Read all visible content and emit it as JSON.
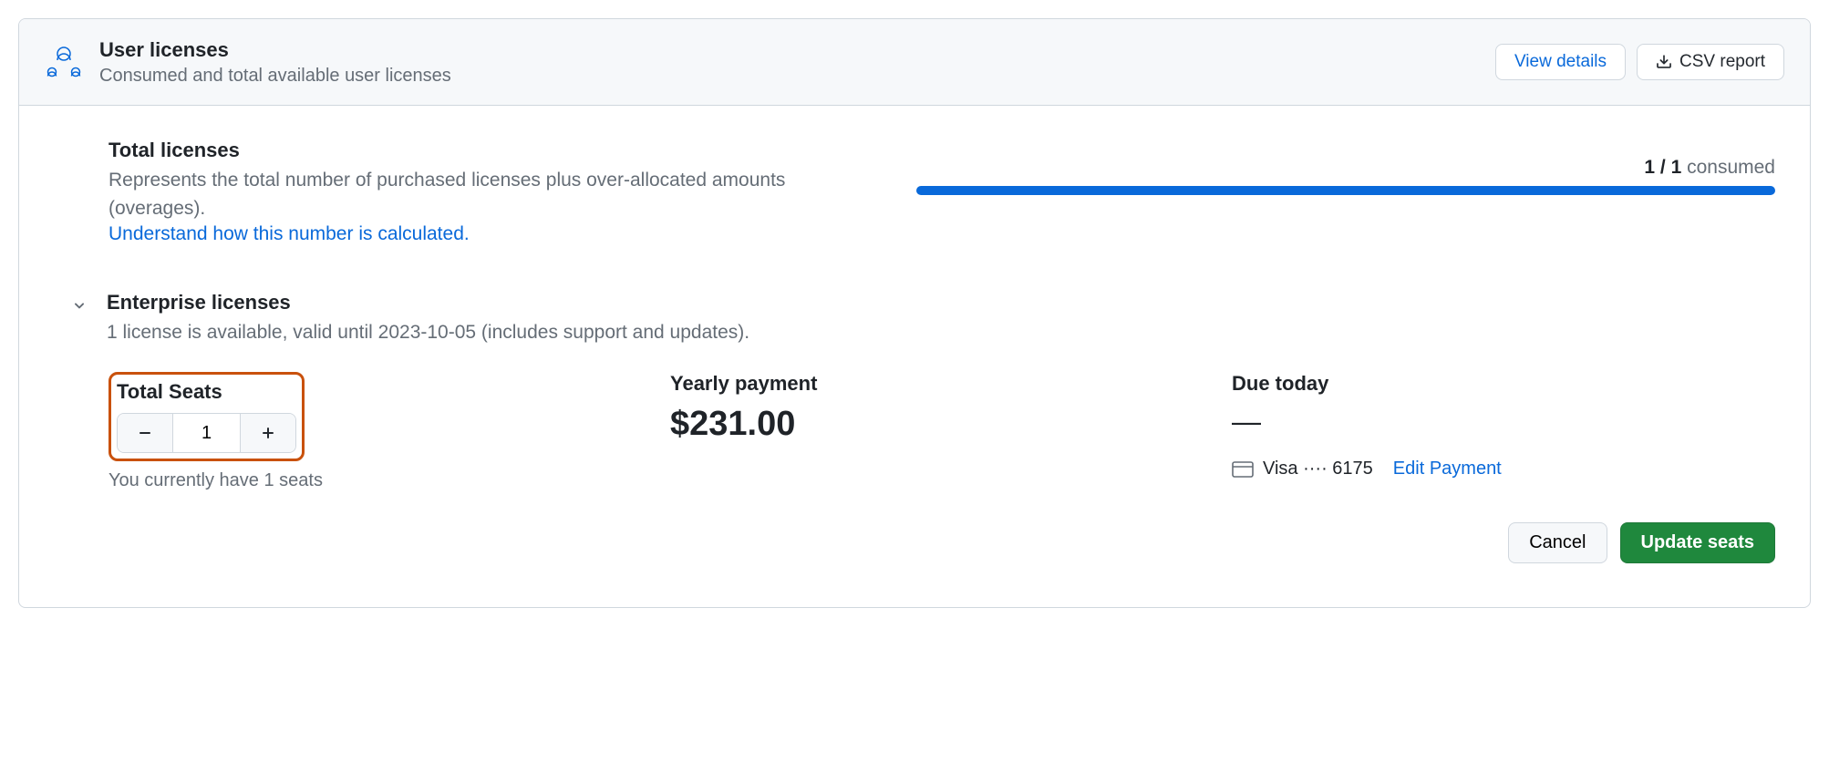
{
  "header": {
    "title": "User licenses",
    "subtitle": "Consumed and total available user licenses",
    "view_details": "View details",
    "csv_report": "CSV report"
  },
  "total_licenses": {
    "title": "Total licenses",
    "desc": "Represents the total number of purchased licenses plus over-allocated amounts (overages).",
    "link": "Understand how this number is calculated.",
    "consumed_count": "1 / 1",
    "consumed_word": " consumed"
  },
  "enterprise": {
    "title": "Enterprise licenses",
    "desc": "1 license is available, valid until 2023-10-05 (includes support and updates)."
  },
  "seats": {
    "label": "Total Seats",
    "value": "1",
    "helper": "You currently have 1 seats"
  },
  "yearly": {
    "label": "Yearly payment",
    "amount": "$231.00"
  },
  "due": {
    "label": "Due today",
    "amount": "—",
    "card_text": "Visa ···· 6175",
    "edit": "Edit Payment"
  },
  "actions": {
    "cancel": "Cancel",
    "update": "Update seats"
  }
}
